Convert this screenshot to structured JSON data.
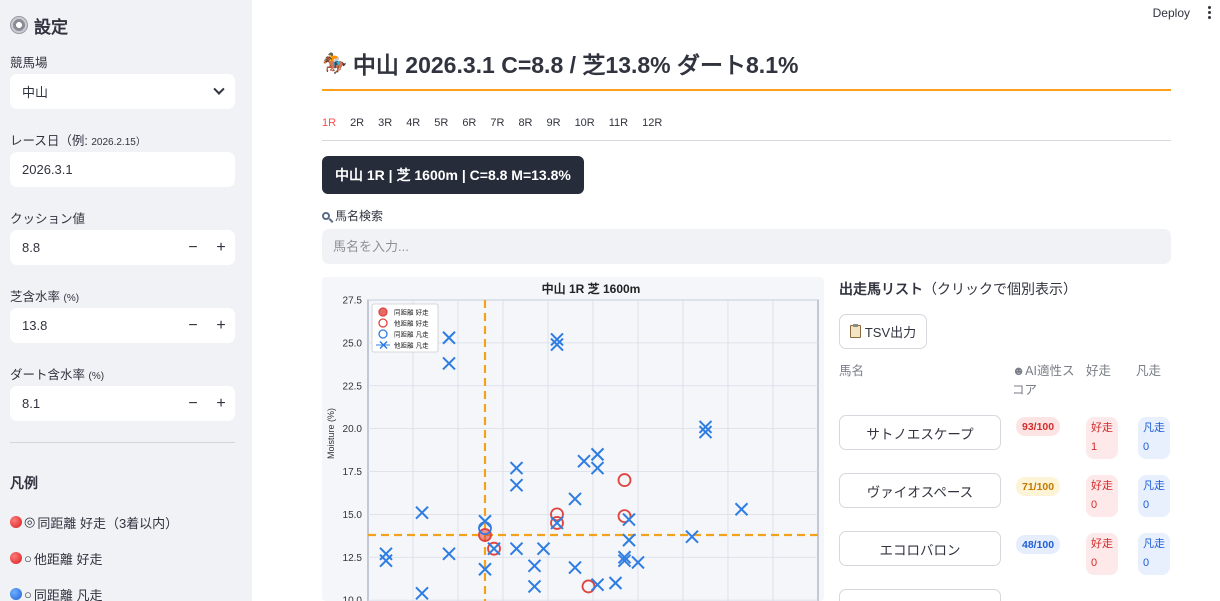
{
  "sidebar": {
    "title": "設定",
    "course_label": "競馬場",
    "course_value": "中山",
    "date_label": "レース日（例: 2026.2.15）",
    "date_label_main": "レース日（例:",
    "date_label_small": "2026.2.15）",
    "date_value": "2026.3.1",
    "cushion_label": "クッション値",
    "cushion_value": "8.8",
    "turf_label_main": "芝含水率",
    "turf_label_small": "(%)",
    "turf_value": "13.8",
    "dirt_label_main": "ダート含水率",
    "dirt_label_small": "(%)",
    "dirt_value": "8.1",
    "minus": "−",
    "plus": "+",
    "legend_title": "凡例",
    "legend": [
      {
        "symbol": "◎",
        "text": "同距離 好走（3着以内）",
        "color": "red"
      },
      {
        "symbol": "○",
        "text": "他距離 好走",
        "color": "red"
      },
      {
        "symbol": "○",
        "text": "同距離 凡走",
        "color": "blue"
      }
    ]
  },
  "header": {
    "deploy": "Deploy"
  },
  "main": {
    "title": "中山 2026.3.1 C=8.8 / 芝13.8% ダート8.1%",
    "tabs": [
      "1R",
      "2R",
      "3R",
      "4R",
      "5R",
      "6R",
      "7R",
      "8R",
      "9R",
      "10R",
      "11R",
      "12R"
    ],
    "active_tab": "1R",
    "race_badge": "中山 1R | 芝 1600m | C=8.8 M=13.8%",
    "search_label": "馬名検索",
    "search_placeholder": "馬名を入力...",
    "list_title_bold": "出走馬リスト",
    "list_title_rest": "（クリックで個別表示）",
    "tsv_button": "TSV出力",
    "col_name": "馬名",
    "col_score_line1": "AI適性ス",
    "col_score_line2": "コア",
    "col_good": "好走",
    "col_bad": "凡走",
    "horses": [
      {
        "name": "サトノエスケープ",
        "score": "93/100",
        "good_label": "好走",
        "good": "1",
        "bad_label": "凡走",
        "bad": "0"
      },
      {
        "name": "ヴァイオスペース",
        "score": "71/100",
        "good_label": "好走",
        "good": "0",
        "bad_label": "凡走",
        "bad": "0"
      },
      {
        "name": "エコロバロン",
        "score": "48/100",
        "good_label": "好走",
        "good": "0",
        "bad_label": "凡走",
        "bad": "0"
      }
    ],
    "score_colors": [
      "#d42b2b",
      "#c47a00",
      "#1e5ed6"
    ]
  },
  "chart_data": {
    "type": "scatter",
    "title": "中山 1R 芝 1600m",
    "xlabel": "",
    "ylabel": "Moisture (%)",
    "ylim": [
      9.6,
      27.5
    ],
    "xlim": [
      0,
      1
    ],
    "yticks": [
      10.0,
      12.5,
      15.0,
      17.5,
      20.0,
      22.5,
      25.0,
      27.5
    ],
    "grid": true,
    "legend_position": "top-left",
    "legend": [
      "同距離 好走",
      "他距離 好走",
      "同距離 凡走",
      "他距離 凡走"
    ],
    "reference_lines": {
      "x": 0.26,
      "y": 13.8,
      "color": "#f2a31b"
    },
    "series": [
      {
        "name": "同距離 好走",
        "marker": "filled-circle",
        "color": "#e0443e",
        "points": [
          [
            0.26,
            13.8
          ]
        ]
      },
      {
        "name": "他距離 好走",
        "marker": "open-circle",
        "color": "#e0443e",
        "points": [
          [
            0.26,
            13.8
          ],
          [
            0.28,
            13.0
          ],
          [
            0.42,
            15.0
          ],
          [
            0.42,
            14.5
          ],
          [
            0.49,
            10.8
          ],
          [
            0.57,
            17.0
          ],
          [
            0.57,
            14.9
          ]
        ]
      },
      {
        "name": "同距離 凡走",
        "marker": "open-circle",
        "color": "#2f7de1",
        "points": [
          [
            0.26,
            14.2
          ]
        ]
      },
      {
        "name": "他距離 凡走",
        "marker": "x",
        "color": "#2f7de1",
        "points": [
          [
            0.18,
            25.3
          ],
          [
            0.18,
            23.8
          ],
          [
            0.42,
            25.2
          ],
          [
            0.42,
            24.9
          ],
          [
            0.12,
            15.1
          ],
          [
            0.04,
            12.7
          ],
          [
            0.04,
            12.3
          ],
          [
            0.18,
            12.7
          ],
          [
            0.12,
            10.4
          ],
          [
            0.26,
            14.6
          ],
          [
            0.26,
            11.8
          ],
          [
            0.28,
            13.0
          ],
          [
            0.33,
            17.7
          ],
          [
            0.33,
            16.7
          ],
          [
            0.33,
            13.0
          ],
          [
            0.37,
            12.0
          ],
          [
            0.37,
            10.8
          ],
          [
            0.39,
            13.0
          ],
          [
            0.42,
            14.5
          ],
          [
            0.46,
            15.9
          ],
          [
            0.46,
            11.9
          ],
          [
            0.48,
            18.1
          ],
          [
            0.51,
            18.5
          ],
          [
            0.51,
            17.7
          ],
          [
            0.51,
            10.9
          ],
          [
            0.55,
            11.0
          ],
          [
            0.57,
            12.5
          ],
          [
            0.57,
            12.3
          ],
          [
            0.58,
            14.7
          ],
          [
            0.58,
            13.5
          ],
          [
            0.6,
            12.2
          ],
          [
            0.72,
            13.7
          ],
          [
            0.75,
            20.1
          ],
          [
            0.75,
            19.8
          ],
          [
            0.83,
            15.3
          ]
        ]
      }
    ]
  }
}
